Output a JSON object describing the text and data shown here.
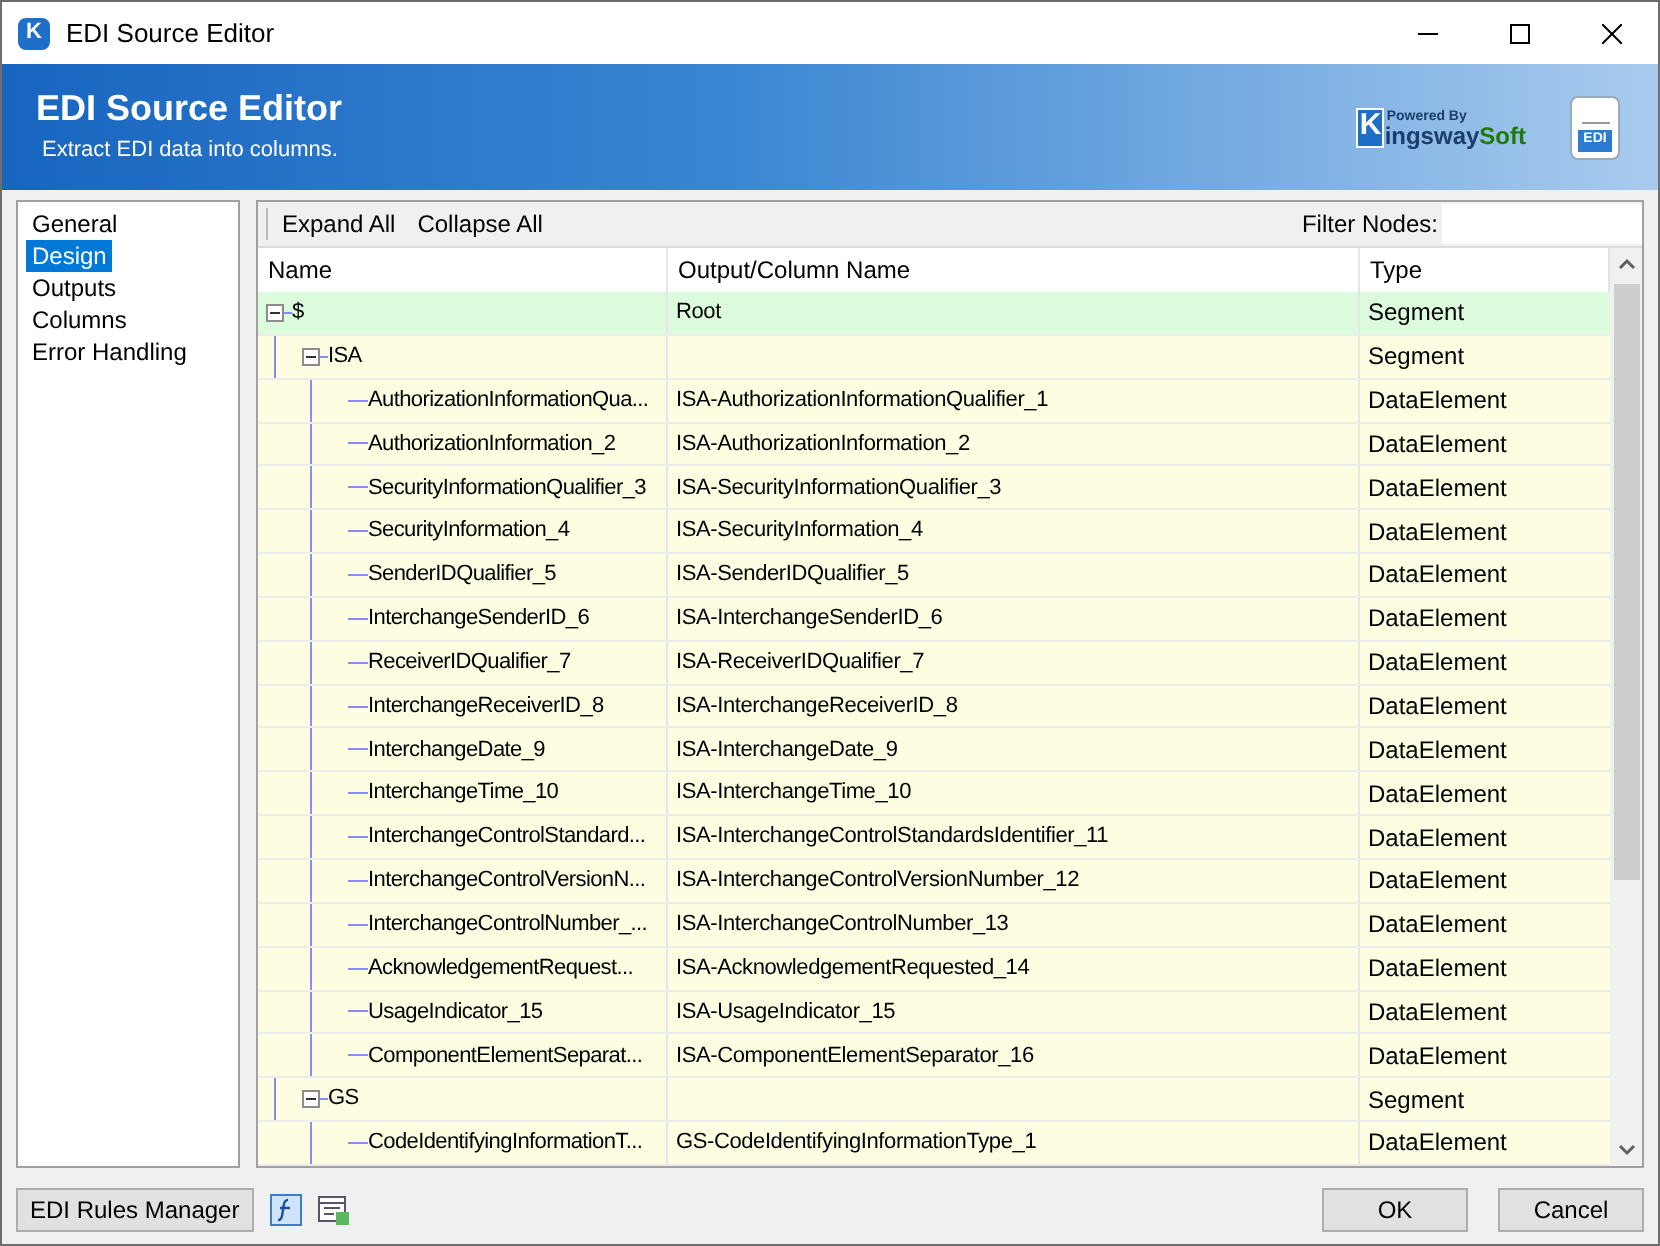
{
  "window": {
    "title": "EDI Source Editor",
    "icon_letter": "K"
  },
  "banner": {
    "title": "EDI Source Editor",
    "subtitle": "Extract EDI data into columns.",
    "logo_small": "Powered By",
    "logo_k": "K",
    "logo_main": "ingsway",
    "logo_accent": "Soft",
    "doc_icon_label": "EDI"
  },
  "sidebar": {
    "items": [
      {
        "label": "General",
        "selected": false
      },
      {
        "label": "Design",
        "selected": true
      },
      {
        "label": "Outputs",
        "selected": false
      },
      {
        "label": "Columns",
        "selected": false
      },
      {
        "label": "Error Handling",
        "selected": false
      }
    ]
  },
  "toolbar": {
    "buttons": [
      "Expand All",
      "Collapse All"
    ],
    "filter_label": "Filter Nodes:"
  },
  "tree": {
    "columns": [
      "Name",
      "Output/Column Name",
      "Type"
    ],
    "nodes": [
      {
        "name": "$",
        "output": "Root",
        "type": "Segment",
        "expanded": true,
        "selected": true,
        "children": [
          {
            "name": "ISA",
            "type": "Segment",
            "expanded": true,
            "selected": false,
            "children": [
              {
                "name": "AuthorizationInformationQua...",
                "output": "ISA-AuthorizationInformationQualifier_1",
                "type": "DataElement",
                "selected": false
              },
              {
                "name": "AuthorizationInformation_2",
                "output": "ISA-AuthorizationInformation_2",
                "type": "DataElement",
                "selected": false
              },
              {
                "name": "SecurityInformationQualifier_3",
                "output": "ISA-SecurityInformationQualifier_3",
                "type": "DataElement",
                "selected": false
              },
              {
                "name": "SecurityInformation_4",
                "output": "ISA-SecurityInformation_4",
                "type": "DataElement",
                "selected": false
              },
              {
                "name": "SenderIDQualifier_5",
                "output": "ISA-SenderIDQualifier_5",
                "type": "DataElement",
                "selected": false
              },
              {
                "name": "InterchangeSenderID_6",
                "output": "ISA-InterchangeSenderID_6",
                "type": "DataElement",
                "selected": false
              },
              {
                "name": "ReceiverIDQualifier_7",
                "output": "ISA-ReceiverIDQualifier_7",
                "type": "DataElement",
                "selected": false
              },
              {
                "name": "InterchangeReceiverID_8",
                "output": "ISA-InterchangeReceiverID_8",
                "type": "DataElement",
                "selected": false
              },
              {
                "name": "InterchangeDate_9",
                "output": "ISA-InterchangeDate_9",
                "type": "DataElement",
                "selected": false
              },
              {
                "name": "InterchangeTime_10",
                "output": "ISA-InterchangeTime_10",
                "type": "DataElement",
                "selected": false
              },
              {
                "name": "InterchangeControlStandard...",
                "output": "ISA-InterchangeControlStandardsIdentifier_11",
                "type": "DataElement",
                "selected": false
              },
              {
                "name": "InterchangeControlVersionN...",
                "output": "ISA-InterchangeControlVersionNumber_12",
                "type": "DataElement",
                "selected": false
              },
              {
                "name": "InterchangeControlNumber_...",
                "output": "ISA-InterchangeControlNumber_13",
                "type": "DataElement",
                "selected": false
              },
              {
                "name": "AcknowledgementRequest...",
                "output": "ISA-AcknowledgementRequested_14",
                "type": "DataElement",
                "selected": false
              },
              {
                "name": "UsageIndicator_15",
                "output": "ISA-UsageIndicator_15",
                "type": "DataElement",
                "selected": false
              },
              {
                "name": "ComponentElementSeparat...",
                "output": "ISA-ComponentElementSeparator_16",
                "type": "DataElement",
                "selected": false
              }
            ]
          },
          {
            "name": "GS",
            "type": "Segment",
            "expanded": true,
            "selected": false,
            "children": [
              {
                "name": "CodeIdentifyingInformationT...",
                "output": "GS-CodeIdentifyingInformationType_1",
                "type": "DataElement",
                "selected": false
              }
            ]
          }
        ]
      }
    ]
  },
  "footer": {
    "rules_button": "EDI Rules Manager",
    "buttons": [
      "OK",
      "Cancel"
    ]
  }
}
